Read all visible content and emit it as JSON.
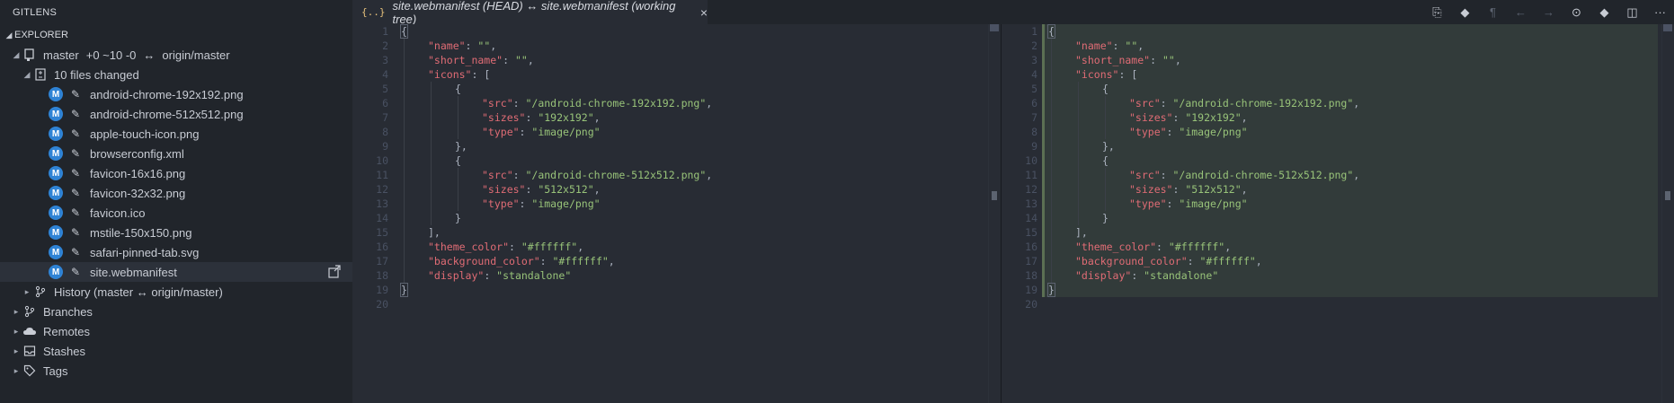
{
  "sidebar": {
    "title": "GITLENS",
    "explorer_label": "EXPLORER",
    "repo": {
      "branch": "master",
      "status": "+0 ~10 -0",
      "arrow": "↔",
      "upstream": "origin/master"
    },
    "changed_label": "10 files changed",
    "files": [
      {
        "badge": "M",
        "name": "android-chrome-192x192.png"
      },
      {
        "badge": "M",
        "name": "android-chrome-512x512.png"
      },
      {
        "badge": "M",
        "name": "apple-touch-icon.png"
      },
      {
        "badge": "M",
        "name": "browserconfig.xml"
      },
      {
        "badge": "M",
        "name": "favicon-16x16.png"
      },
      {
        "badge": "M",
        "name": "favicon-32x32.png"
      },
      {
        "badge": "M",
        "name": "favicon.ico"
      },
      {
        "badge": "M",
        "name": "mstile-150x150.png"
      },
      {
        "badge": "M",
        "name": "safari-pinned-tab.svg"
      },
      {
        "badge": "M",
        "name": "site.webmanifest"
      }
    ],
    "history_label": "History (master ↔ origin/master)",
    "sections": [
      "Branches",
      "Remotes",
      "Stashes",
      "Tags"
    ]
  },
  "tab": {
    "icon": "{..}",
    "title": "site.webmanifest (HEAD) ↔ site.webmanifest (working tree)",
    "close": "×"
  },
  "toolbar": {
    "icons": [
      "open-file-icon",
      "git-compare-icon",
      "pilcrow-icon",
      "arrow-left-icon",
      "arrow-right-icon",
      "toggle-inline-icon",
      "git-commit-icon",
      "split-editor-icon",
      "more-icon"
    ],
    "glyphs": [
      "⎘",
      "◆",
      "¶",
      "←",
      "→",
      "⊙",
      "◆",
      "◫",
      "···"
    ]
  },
  "code": {
    "line_numbers": [
      "1",
      "2",
      "3",
      "4",
      "5",
      "6",
      "7",
      "8",
      "9",
      "10",
      "11",
      "12",
      "13",
      "14",
      "15",
      "16",
      "17",
      "18",
      "19",
      "20"
    ],
    "lines": [
      {
        "indent": 0,
        "k": "",
        "sep": "",
        "v": "",
        "tail": "{"
      },
      {
        "indent": 1,
        "k": "\"name\"",
        "sep": ": ",
        "v": "\"\"",
        "tail": ","
      },
      {
        "indent": 1,
        "k": "\"short_name\"",
        "sep": ": ",
        "v": "\"\"",
        "tail": ","
      },
      {
        "indent": 1,
        "k": "\"icons\"",
        "sep": ": ",
        "v": "",
        "tail": "["
      },
      {
        "indent": 2,
        "k": "",
        "sep": "",
        "v": "",
        "tail": "{"
      },
      {
        "indent": 3,
        "k": "\"src\"",
        "sep": ": ",
        "v": "\"/android-chrome-192x192.png\"",
        "tail": ","
      },
      {
        "indent": 3,
        "k": "\"sizes\"",
        "sep": ": ",
        "v": "\"192x192\"",
        "tail": ","
      },
      {
        "indent": 3,
        "k": "\"type\"",
        "sep": ": ",
        "v": "\"image/png\"",
        "tail": ""
      },
      {
        "indent": 2,
        "k": "",
        "sep": "",
        "v": "",
        "tail": "},"
      },
      {
        "indent": 2,
        "k": "",
        "sep": "",
        "v": "",
        "tail": "{"
      },
      {
        "indent": 3,
        "k": "\"src\"",
        "sep": ": ",
        "v": "\"/android-chrome-512x512.png\"",
        "tail": ","
      },
      {
        "indent": 3,
        "k": "\"sizes\"",
        "sep": ": ",
        "v": "\"512x512\"",
        "tail": ","
      },
      {
        "indent": 3,
        "k": "\"type\"",
        "sep": ": ",
        "v": "\"image/png\"",
        "tail": ""
      },
      {
        "indent": 2,
        "k": "",
        "sep": "",
        "v": "",
        "tail": "}"
      },
      {
        "indent": 1,
        "k": "",
        "sep": "",
        "v": "",
        "tail": "],"
      },
      {
        "indent": 1,
        "k": "\"theme_color\"",
        "sep": ": ",
        "v": "\"#ffffff\"",
        "tail": ","
      },
      {
        "indent": 1,
        "k": "\"background_color\"",
        "sep": ": ",
        "v": "\"#ffffff\"",
        "tail": ","
      },
      {
        "indent": 1,
        "k": "\"display\"",
        "sep": ": ",
        "v": "\"standalone\"",
        "tail": ""
      },
      {
        "indent": 0,
        "k": "",
        "sep": "",
        "v": "",
        "tail": "}"
      },
      {
        "indent": 0,
        "k": "",
        "sep": "",
        "v": "",
        "tail": ""
      }
    ]
  },
  "colors": {
    "key": "#e06c75",
    "string": "#98c379",
    "badge": "#2f83d5",
    "tab_icon": "#e5c07b"
  }
}
